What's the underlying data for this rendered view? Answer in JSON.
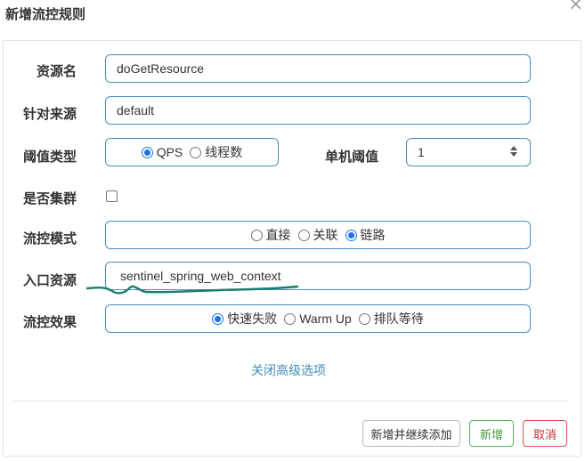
{
  "dialog": {
    "title": "新增流控规则",
    "close_label": "×"
  },
  "form": {
    "resource": {
      "label": "资源名",
      "value": "doGetResource"
    },
    "limit_app": {
      "label": "针对来源",
      "value": "default"
    },
    "threshold_type": {
      "label": "阈值类型",
      "options": [
        {
          "label": "QPS",
          "selected": true
        },
        {
          "label": "线程数",
          "selected": false
        }
      ]
    },
    "single_threshold": {
      "label": "单机阈值",
      "value": "1"
    },
    "cluster": {
      "label": "是否集群",
      "checked": false
    },
    "control_mode": {
      "label": "流控模式",
      "options": [
        {
          "label": "直接",
          "selected": false
        },
        {
          "label": "关联",
          "selected": false
        },
        {
          "label": "链路",
          "selected": true
        }
      ]
    },
    "entry_resource": {
      "label": "入口资源",
      "value": "sentinel_spring_web_context"
    },
    "control_effect": {
      "label": "流控效果",
      "options": [
        {
          "label": "快速失败",
          "selected": true
        },
        {
          "label": "Warm Up",
          "selected": false
        },
        {
          "label": "排队等待",
          "selected": false
        }
      ]
    },
    "advanced_toggle": "关闭高级选项"
  },
  "footer": {
    "add_continue_label": "新增并继续添加",
    "add_label": "新增",
    "cancel_label": "取消"
  },
  "colors": {
    "input_border": "#4a8fbf",
    "radio_selected": "#1a73e8",
    "link": "#3c8dbc",
    "success": "#5cb85c",
    "danger": "#d9534f",
    "annotation_stroke": "#1e7a6e"
  }
}
